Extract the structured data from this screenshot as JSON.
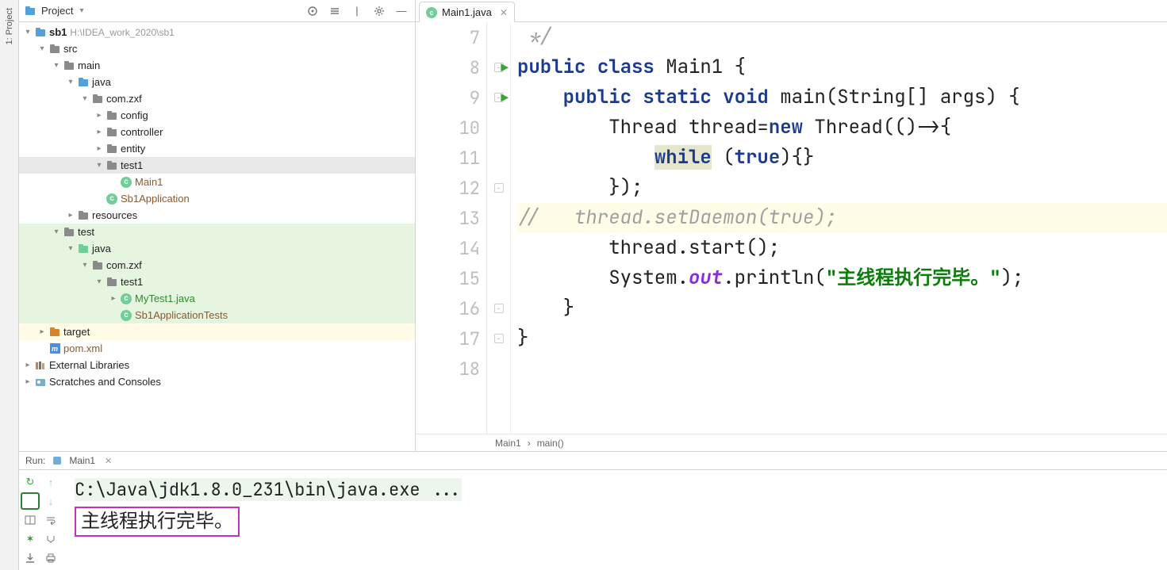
{
  "left_rail": {
    "project_label": "1: Project"
  },
  "project_panel": {
    "title": "Project",
    "root": {
      "name": "sb1",
      "path": "H:\\IDEA_work_2020\\sb1"
    },
    "tree": {
      "src": "src",
      "main": "main",
      "java_main": "java",
      "pkg": "com.zxf",
      "config": "config",
      "controller": "controller",
      "entity": "entity",
      "test1_pkg": "test1",
      "main1_cls": "Main1",
      "sb1app": "Sb1Application",
      "resources": "resources",
      "test": "test",
      "java_test": "java",
      "pkg_test": "com.zxf",
      "test1_testpkg": "test1",
      "mytest1": "MyTest1.java",
      "sb1apptests": "Sb1ApplicationTests",
      "target": "target",
      "pom": "pom.xml",
      "ext_lib": "External Libraries",
      "scratches": "Scratches and Consoles"
    }
  },
  "editor": {
    "tab_name": "Main1.java",
    "gutter": [
      "7",
      "8",
      "9",
      "10",
      "11",
      "12",
      "13",
      "14",
      "15",
      "16",
      "17",
      "18"
    ],
    "code": {
      "l7": " */",
      "l8_kw1": "public",
      "l8_kw2": "class",
      "l8_id": " Main1 {",
      "l9_kw1": "public",
      "l9_kw2": "static",
      "l9_kw3": "void",
      "l9_id": " main(String[] args) {",
      "l10_a": "        Thread thread=",
      "l10_new": "new",
      "l10_b": " Thread(()->{",
      "l11_a": "            ",
      "l11_while": "while",
      "l11_b": " (",
      "l11_true": "true",
      "l11_c": "){}",
      "l12": "        });",
      "l13": "//   thread.setDaemon(true);",
      "l14": "        thread.start();",
      "l15_a": "        System.",
      "l15_out": "out",
      "l15_b": ".println(",
      "l15_str": "\"主线程执行完毕。\"",
      "l15_c": ");",
      "l16": "    }",
      "l17": "}",
      "l18": ""
    },
    "breadcrumb": {
      "cls": "Main1",
      "mtd": "main()"
    }
  },
  "run": {
    "label": "Run:",
    "config": "Main1",
    "console_cmd": "C:\\Java\\jdk1.8.0_231\\bin\\java.exe ...",
    "console_out": "主线程执行完毕。"
  }
}
